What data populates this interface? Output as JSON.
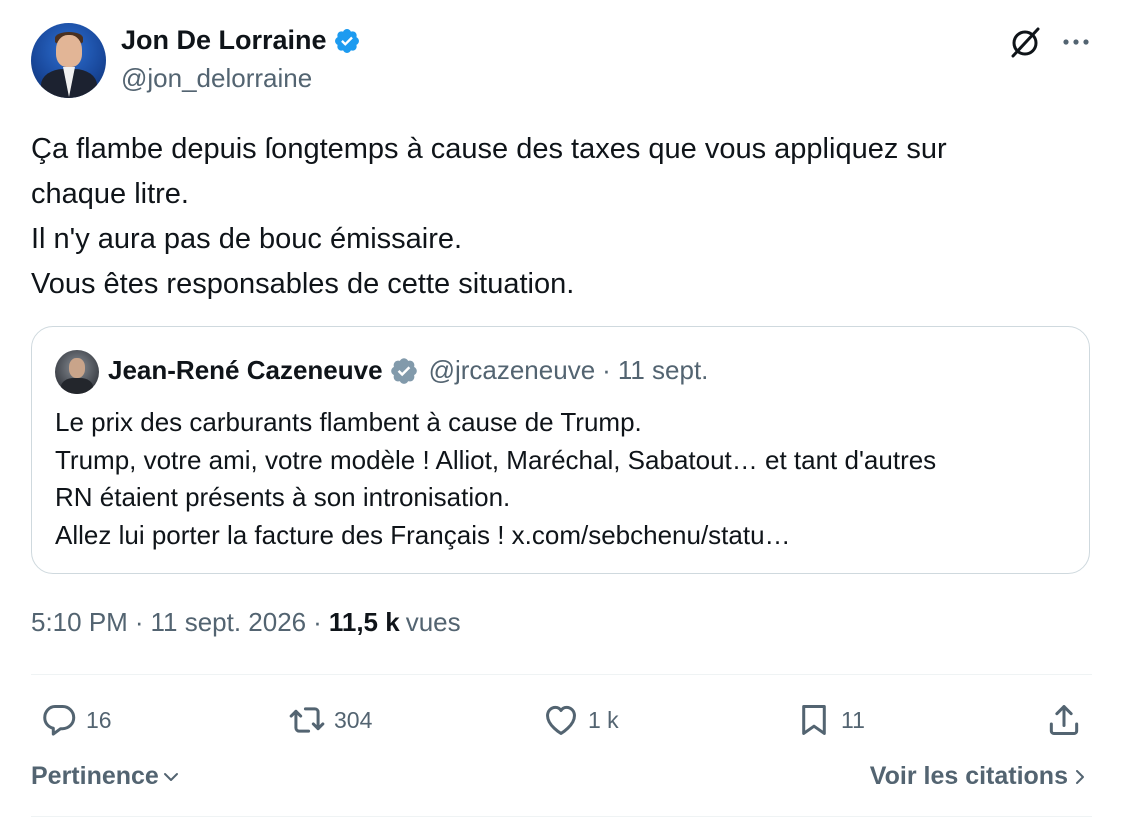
{
  "author": {
    "name": "Jon De Lorraine",
    "handle": "@jon_delorraine",
    "verified_color": "#1d9bf0"
  },
  "tweet": {
    "lines": [
      "Ça flambe depuis ſongtemps à cause des taxes que vous appliquez sur",
      "chaque litre.",
      "Il n'y aura pas de bouc émissaire.",
      "Vous êtes responsables de cette situation."
    ]
  },
  "quote": {
    "name": "Jean-René Cazeneuve",
    "handle": "@jrcazeneuve",
    "separator": "·",
    "date": "11 sept.",
    "verified_color": "#829aab",
    "lines": [
      "Le prix des carburants flambent à cause de Trump.",
      "Trump, votre ami, votre modèle ! Alliot, Maréchal, Sabatout… et tant d'autres",
      "RN étaient présents à son intronisation.",
      "Allez lui porter la facture des Français ! x.com/sebchenu/statu…"
    ]
  },
  "meta": {
    "time": "5:10 PM",
    "separator": "·",
    "date": "11 sept. 2026",
    "views_count": "11,5 k",
    "views_label": "vues"
  },
  "actions": {
    "replies": "16",
    "retweets": "304",
    "likes": "1 k",
    "bookmarks": "11"
  },
  "footer": {
    "sort_label": "Pertinence",
    "quotes_label": "Voir les citations"
  },
  "icons": {
    "grok": "grok-icon",
    "more": "more-icon",
    "reply": "reply-icon",
    "retweet": "retweet-icon",
    "like": "heart-icon",
    "bookmark": "bookmark-icon",
    "share": "share-icon"
  },
  "colors": {
    "text_primary": "#0f1419",
    "text_secondary": "#536471",
    "border": "#cfd9de",
    "divider": "#eff3f4"
  }
}
